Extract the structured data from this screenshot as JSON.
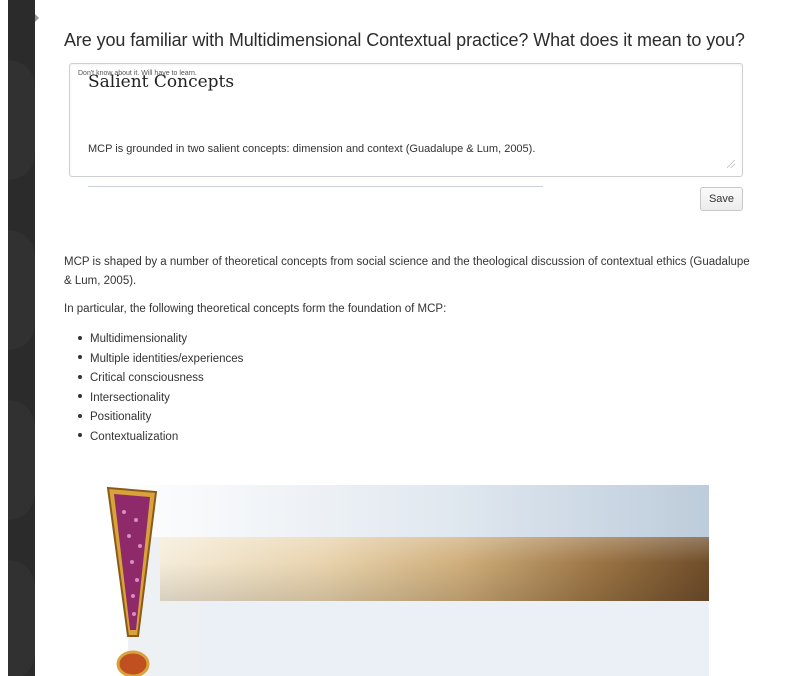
{
  "question": {
    "text": "Are you familiar with Multidimensional Contextual practice? What does it mean to you?",
    "answer": "Don't know about it. Will have to learn."
  },
  "save_label": "Save",
  "intro": {
    "p1": "MCP is shaped by a number of theoretical concepts from social science and the theological discussion of contextual ethics (Guadalupe & Lum, 2005).",
    "p2": "In particular, the following theoretical concepts form the foundation of MCP:"
  },
  "concepts": [
    "Multidimensionality",
    "Multiple identities/experiences",
    "Critical consciousness",
    "Intersectionality",
    "Positionality",
    "Contextualization"
  ],
  "salient": {
    "title": "Salient Concepts",
    "body": "MCP is grounded in two salient concepts: dimension and context (Guadalupe & Lum, 2005)."
  },
  "colors": {
    "sidebar": "#2b2b2b",
    "exclaim_fill": "#8e2a6a",
    "exclaim_border": "#d9a23a"
  }
}
